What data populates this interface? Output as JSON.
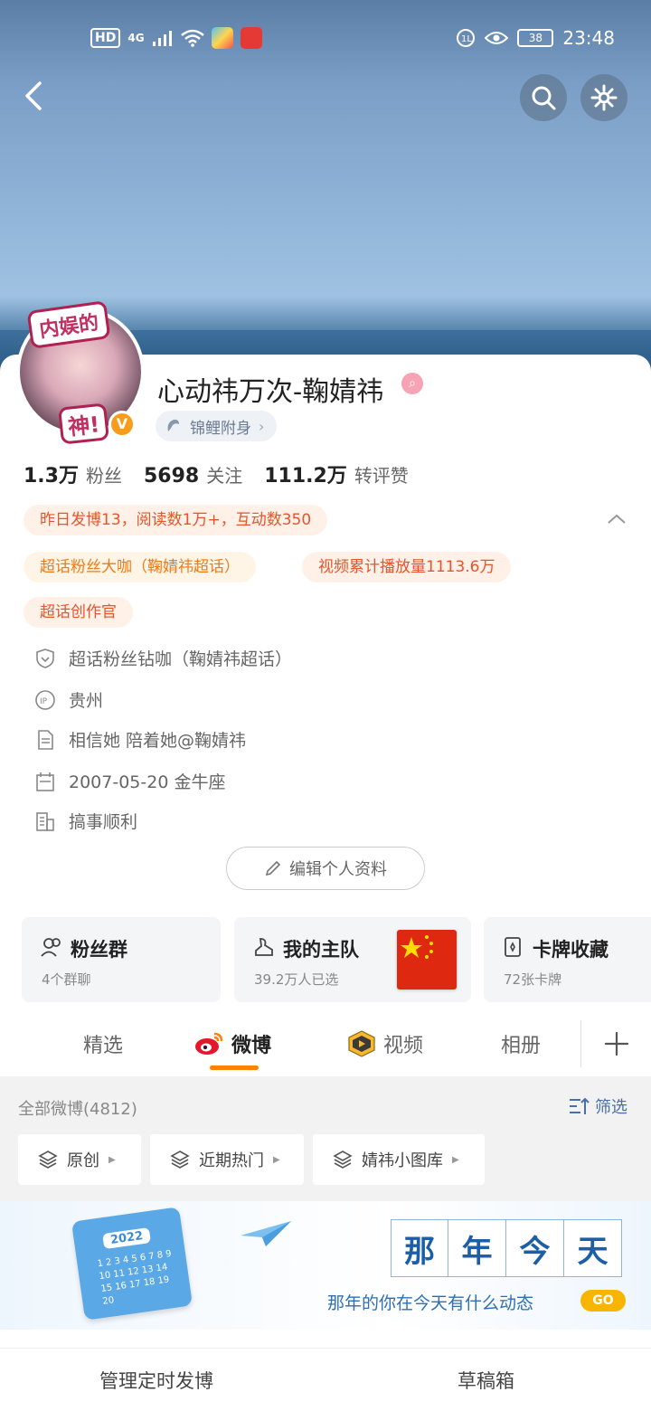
{
  "status_bar": {
    "left_badges": [
      "HD",
      "4G"
    ],
    "battery": "38",
    "time": "23:48"
  },
  "profile": {
    "avatar_text_top": "内娱的",
    "avatar_text_bottom": "神!",
    "verified_mark": "V",
    "nickname": "心动祎万次-鞠婧祎",
    "nick_badge": "⌕",
    "lucky_label": "锦鲤附身",
    "stats": [
      {
        "num": "1.3万",
        "label": "粉丝"
      },
      {
        "num": "5698",
        "label": "关注"
      },
      {
        "num": "111.2万",
        "label": "转评赞"
      }
    ],
    "tags": {
      "yesterday": "昨日发博13，阅读数1万+，互动数350",
      "super_fan": "超话粉丝大咖（鞠婧祎超话）",
      "video": "视频累计播放量1113.6万",
      "creator": "超话创作官"
    },
    "info": {
      "fan_level": "超话粉丝钻咖（鞠婧祎超话）",
      "ip": "贵州",
      "bio": "相信她 陪着她@鞠婧祎",
      "birthday": "2007-05-20 金牛座",
      "wish": "搞事顺利"
    },
    "edit_label": "编辑个人资料"
  },
  "features": [
    {
      "title": "粉丝群",
      "sub": "4个群聊",
      "icon": "group-icon"
    },
    {
      "title": "我的主队",
      "sub": "39.2万人已选",
      "icon": "team-icon"
    },
    {
      "title": "卡牌收藏",
      "sub": "72张卡牌",
      "icon": "card-icon"
    }
  ],
  "tabs": [
    "精选",
    "微博",
    "视频",
    "相册"
  ],
  "feed": {
    "all_label": "全部微博(4812)",
    "filter_label": "筛选",
    "chips": [
      "原创",
      "近期热门",
      "婧祎小图库"
    ]
  },
  "promo": {
    "calendar_year": "2022",
    "calendar_days": "1 2 3 4 5 6 7 8 9 10 11 12 13 14 15 16 17 18 19 20",
    "title_chars": [
      "那",
      "年",
      "今",
      "天"
    ],
    "subtitle": "那年的你在今天有什么动态",
    "go": "GO"
  },
  "bottom": {
    "left": "管理定时发博",
    "right": "草稿箱"
  },
  "colors": {
    "accent_orange": "#ff8200",
    "tag_red": "#e4552a",
    "tag_gold": "#ef7a16",
    "link_blue": "#4a6fa5"
  }
}
